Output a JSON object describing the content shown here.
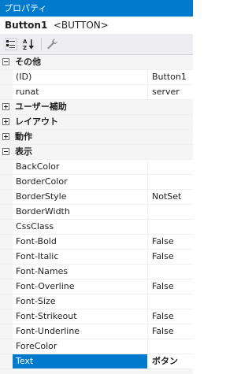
{
  "window": {
    "title": "プロパティ"
  },
  "object": {
    "name": "Button1",
    "type": "<BUTTON>"
  },
  "toolbar": {
    "buttons": [
      {
        "icon": "categorized-view-icon"
      },
      {
        "icon": "alphabetical-sort-icon"
      },
      {
        "icon": "property-pages-wrench-icon"
      }
    ]
  },
  "categories": {
    "misc": {
      "label": "その他",
      "expanded": true
    },
    "accessibility": {
      "label": "ユーザー補助",
      "expanded": false
    },
    "layout": {
      "label": "レイアウト",
      "expanded": false
    },
    "behavior": {
      "label": "動作",
      "expanded": false
    },
    "appearance": {
      "label": "表示",
      "expanded": true
    }
  },
  "misc_props": [
    {
      "name": "(ID)",
      "value": "Button1"
    },
    {
      "name": "runat",
      "value": "server"
    }
  ],
  "appearance_props": [
    {
      "name": "BackColor",
      "value": ""
    },
    {
      "name": "BorderColor",
      "value": ""
    },
    {
      "name": "BorderStyle",
      "value": "NotSet"
    },
    {
      "name": "BorderWidth",
      "value": ""
    },
    {
      "name": "CssClass",
      "value": ""
    },
    {
      "name": "Font-Bold",
      "value": "False"
    },
    {
      "name": "Font-Italic",
      "value": "False"
    },
    {
      "name": "Font-Names",
      "value": ""
    },
    {
      "name": "Font-Overline",
      "value": "False"
    },
    {
      "name": "Font-Size",
      "value": ""
    },
    {
      "name": "Font-Strikeout",
      "value": "False"
    },
    {
      "name": "Font-Underline",
      "value": "False"
    },
    {
      "name": "ForeColor",
      "value": ""
    },
    {
      "name": "Text",
      "value": "ボタン",
      "selected": true
    }
  ],
  "colors": {
    "accent": "#007acc",
    "toolbar_bg": "#eeeef2",
    "category_bg": "#f5f5f5",
    "grid_line": "#f0f0f0"
  }
}
